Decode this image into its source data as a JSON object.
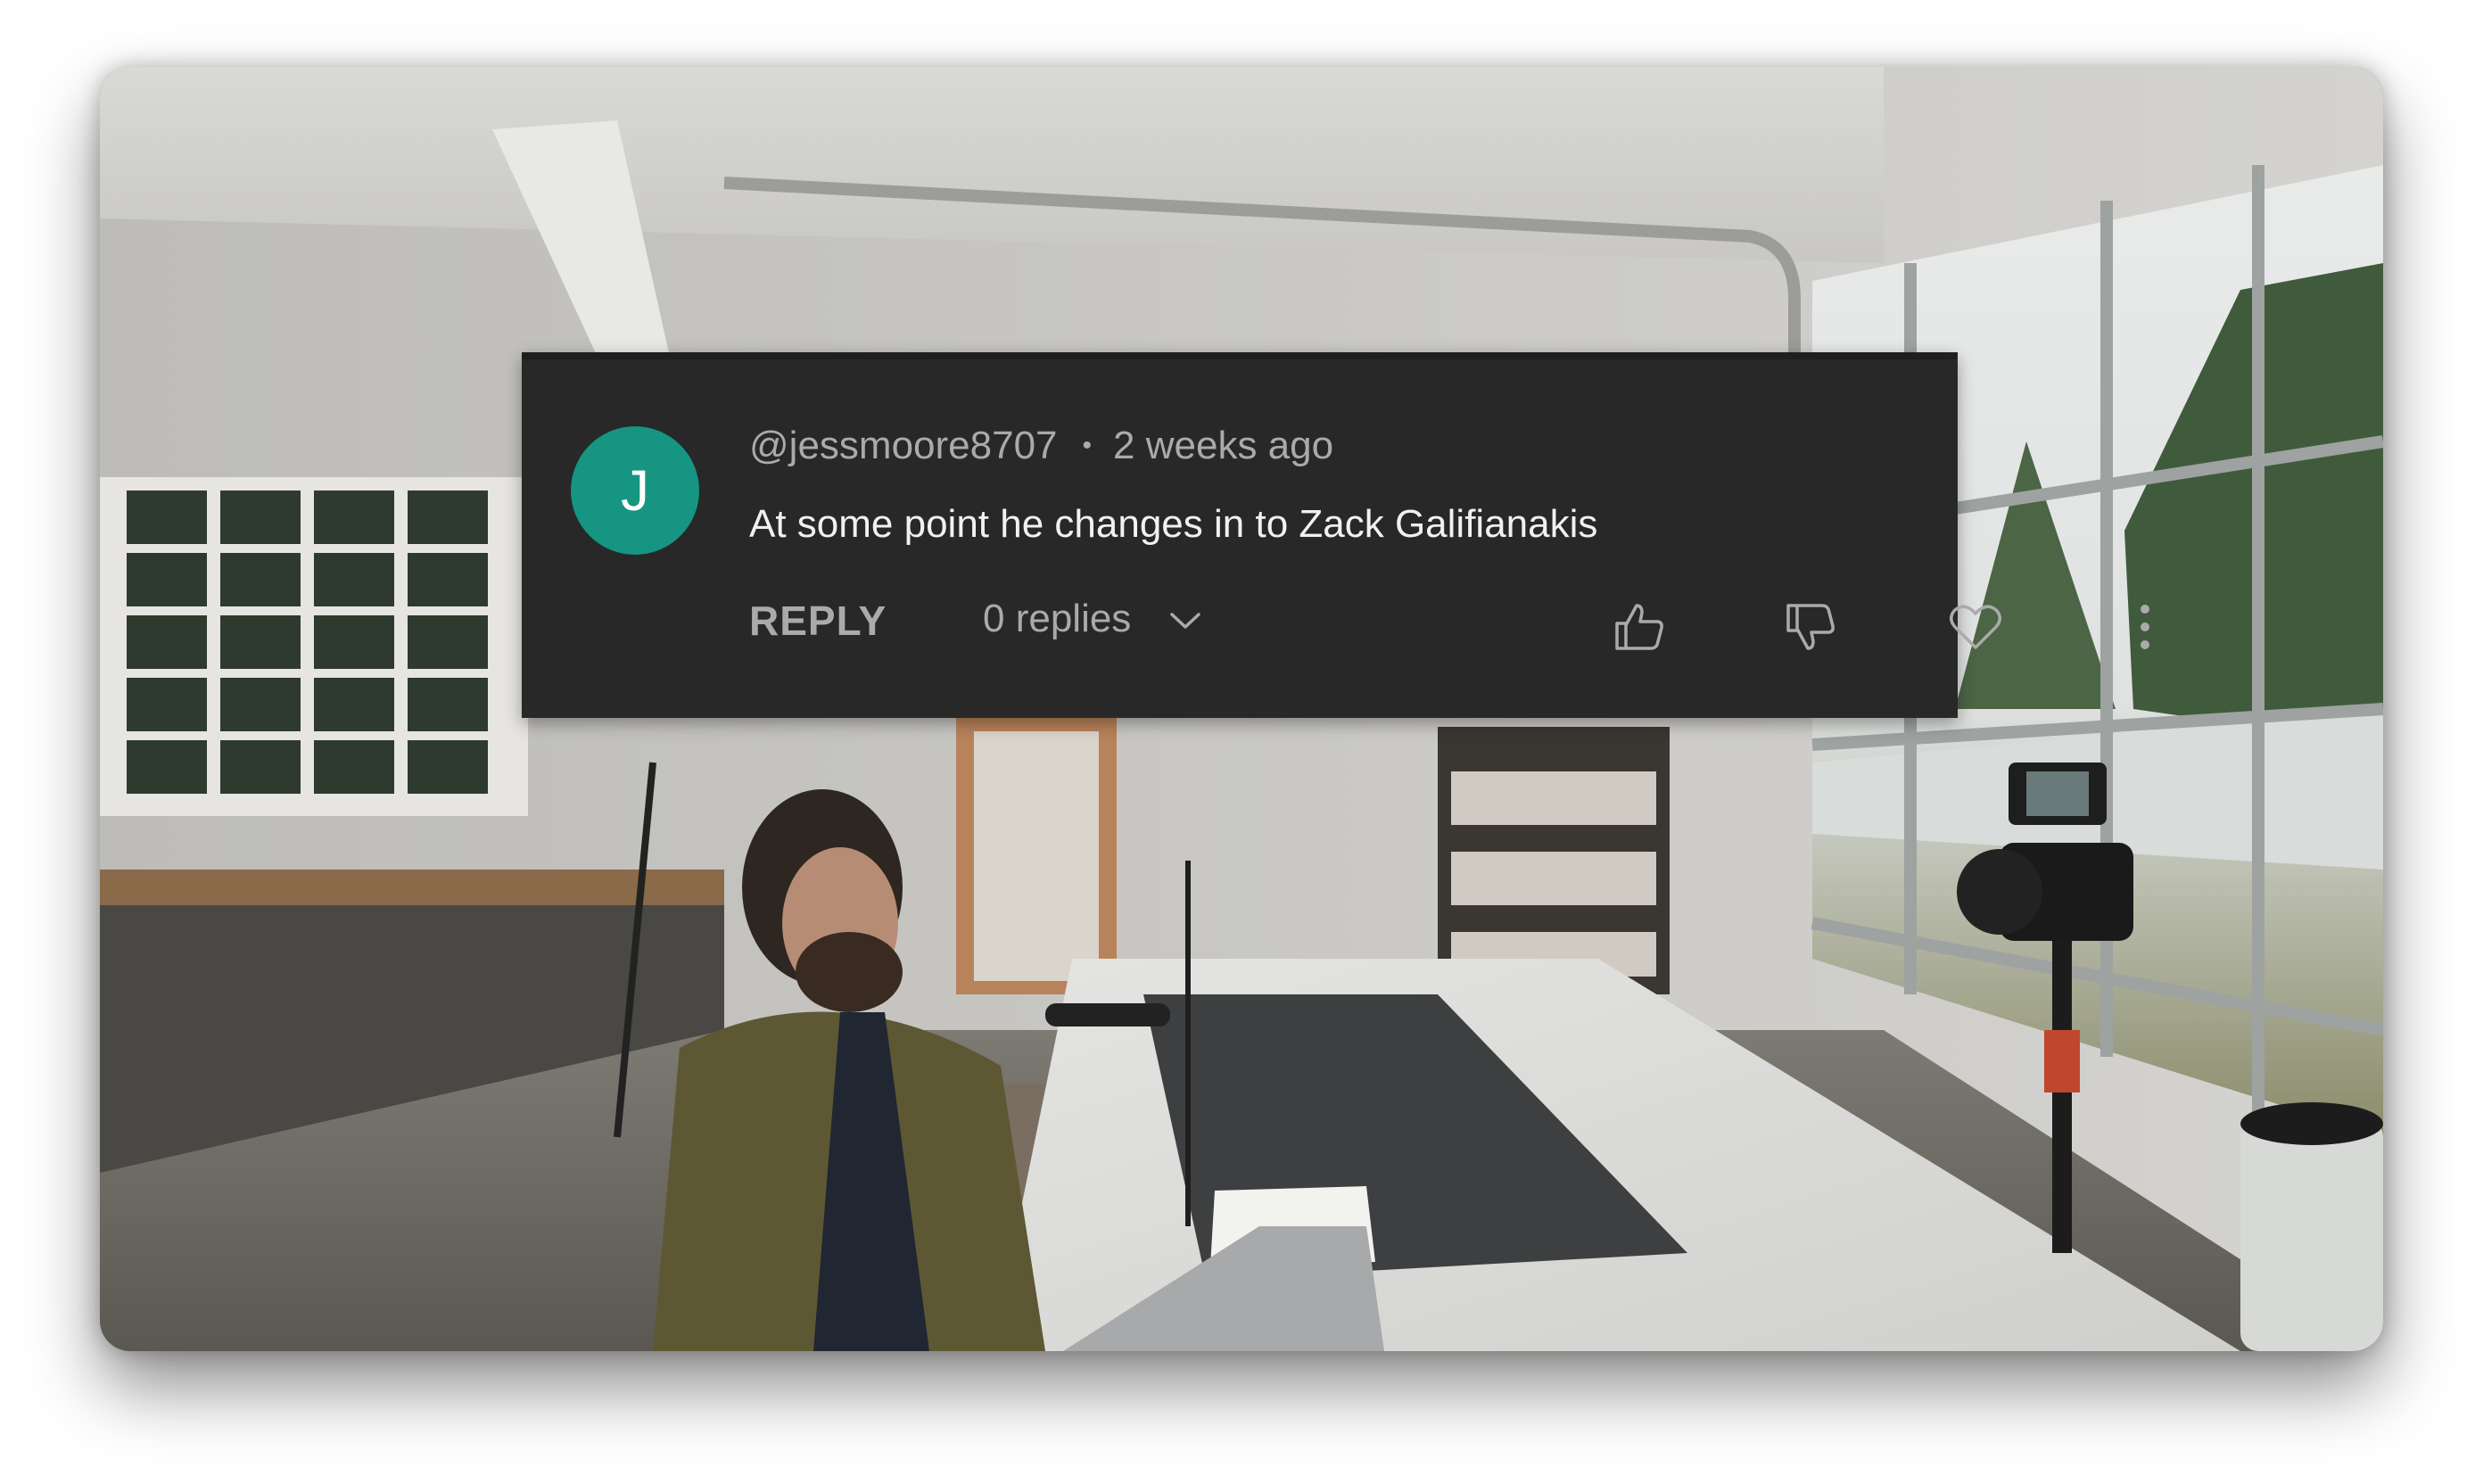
{
  "comment": {
    "avatar_initial": "J",
    "avatar_color": "#159582",
    "author": "@jessmoore8707",
    "separator": "•",
    "timestamp": "2 weeks ago",
    "text": "At some point he changes in to Zack Galifianakis",
    "reply_label": "REPLY",
    "replies_label": "0 replies"
  },
  "icons": {
    "replies_expand": "chevron-down-icon",
    "like": "thumbs-up-icon",
    "dislike": "thumbs-down-icon",
    "heart": "heart-icon",
    "more": "more-vertical-icon"
  },
  "colors": {
    "card_background": "#282828",
    "primary_text": "#f1f1f1",
    "secondary_text": "#aaaaaa"
  }
}
